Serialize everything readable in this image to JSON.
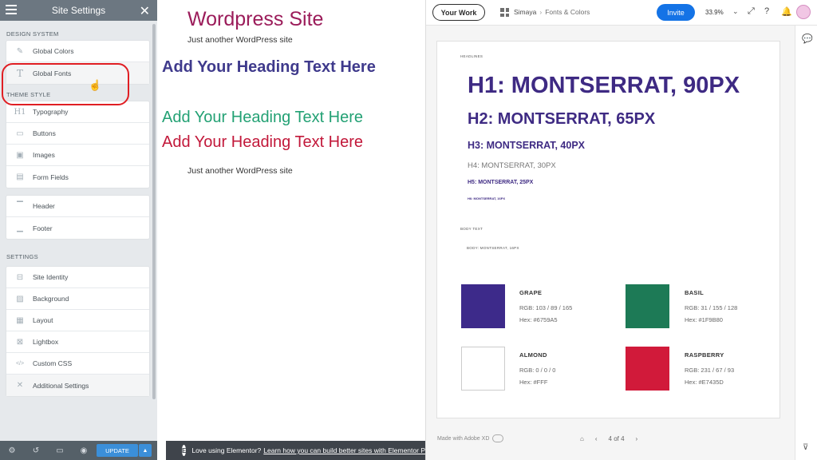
{
  "sidebar": {
    "title": "Site Settings",
    "sections": {
      "design_system": "DESIGN SYSTEM",
      "theme_style": "THEME STYLE",
      "settings": "SETTINGS"
    },
    "design_items": [
      {
        "label": "Global Colors",
        "icon": "brush-icon"
      },
      {
        "label": "Global Fonts",
        "icon": "text-icon"
      }
    ],
    "theme_items": [
      {
        "label": "Typography",
        "icon": "heading-icon"
      },
      {
        "label": "Buttons",
        "icon": "button-icon"
      },
      {
        "label": "Images",
        "icon": "image-icon"
      },
      {
        "label": "Form Fields",
        "icon": "form-icon"
      }
    ],
    "layout_items": [
      {
        "label": "Header",
        "icon": "header-icon"
      },
      {
        "label": "Footer",
        "icon": "footer-icon"
      }
    ],
    "settings_items": [
      {
        "label": "Site Identity",
        "icon": "identity-icon"
      },
      {
        "label": "Background",
        "icon": "background-icon"
      },
      {
        "label": "Layout",
        "icon": "layout-icon"
      },
      {
        "label": "Lightbox",
        "icon": "lightbox-icon"
      },
      {
        "label": "Custom CSS",
        "icon": "code-icon"
      },
      {
        "label": "Additional Settings",
        "icon": "tools-icon"
      }
    ],
    "footer": {
      "update_label": "UPDATE"
    }
  },
  "preview": {
    "site_title": "Wordpress Site",
    "tagline": "Just another WordPress site",
    "heading_purple": "Add Your Heading Text Here",
    "heading_green": "Add Your Heading Text Here",
    "heading_red": "Add Your Heading Text Here",
    "tagline_2": "Just another WordPress site"
  },
  "bottom_bar": {
    "text": "Love using Elementor?",
    "link": "Learn how you can build better sites with Elementor Pro."
  },
  "xd": {
    "your_work": "Your Work",
    "breadcrumb": {
      "root": "Simaya",
      "current": "Fonts & Colors"
    },
    "invite": "Invite",
    "zoom": "33.9%",
    "artboard": {
      "headlines_label": "HEADLINES",
      "h1": "H1: MONTSERRAT, 90PX",
      "h2": "H2: MONTSERRAT, 65PX",
      "h3": "H3: MONTSERRAT, 40PX",
      "h4": "H4: MONTSERRAT, 30PX",
      "h5": "H5: MONTSERRAT, 25PX",
      "h6": "H6: MONTSERRAT, 16PX",
      "body_label": "BODY TEXT",
      "body": "BODY: MONTSERRAT, 16PX",
      "colors": [
        {
          "name": "GRAPE",
          "rgb": "RGB: 103 / 89 / 165",
          "hex": "Hex: #6759A5",
          "color": "#3d2a8a"
        },
        {
          "name": "BASIL",
          "rgb": "RGB: 31 / 155 / 128",
          "hex": "Hex: #1F9B80",
          "color": "#1d7a56"
        },
        {
          "name": "ALMOND",
          "rgb": "RGB: 0 / 0 / 0",
          "hex": "Hex: #FFF",
          "color": "#ffffff"
        },
        {
          "name": "RASPBERRY",
          "rgb": "RGB: 231 / 67 / 93",
          "hex": "Hex: #E7435D",
          "color": "#d11a3a"
        }
      ]
    },
    "made_with": "Made with Adobe XD",
    "page": "4 of 4"
  },
  "colors": {
    "elementor_header": "#6c7781",
    "elementor_panel": "#e6e9ec",
    "update_blue": "#3b8fd9",
    "invite_blue": "#1473e6",
    "annotation_red": "#e01e23"
  }
}
